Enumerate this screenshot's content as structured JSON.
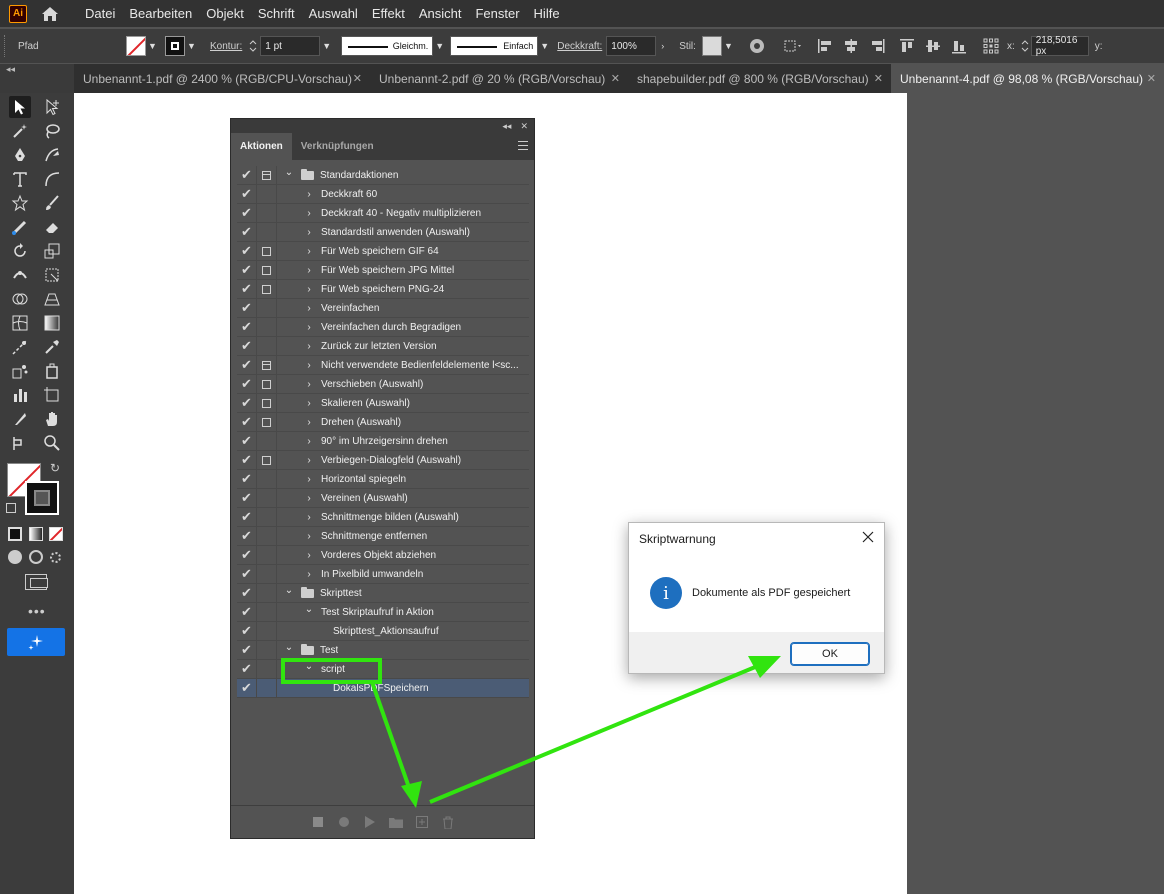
{
  "app": {
    "logo": "Ai"
  },
  "menu": [
    "Datei",
    "Bearbeiten",
    "Objekt",
    "Schrift",
    "Auswahl",
    "Effekt",
    "Ansicht",
    "Fenster",
    "Hilfe"
  ],
  "control": {
    "selection_type": "Pfad",
    "kontur_label": "Kontur:",
    "kontur_value": "1 pt",
    "line1": "Gleichm.",
    "line2": "Einfach",
    "deckkraft_label": "Deckkraft:",
    "deckkraft_value": "100%",
    "stil_label": "Stil:",
    "x_label": "x:",
    "x_value": "218,5016 px",
    "y_label": "y:"
  },
  "tabs": [
    {
      "label": "Unbenannt-1.pdf @ 2400 % (RGB/CPU-Vorschau)",
      "active": false
    },
    {
      "label": "Unbenannt-2.pdf @ 20 % (RGB/Vorschau)",
      "active": false
    },
    {
      "label": "shapebuilder.pdf @ 800 % (RGB/Vorschau)",
      "active": false
    },
    {
      "label": "Unbenannt-4.pdf @ 98,08 % (RGB/Vorschau)",
      "active": true
    }
  ],
  "panel": {
    "tab_actions": "Aktionen",
    "tab_links": "Verknüpfungen",
    "rows": [
      {
        "label": "Standardaktionen",
        "level": 0,
        "kind": "set",
        "expanded": true,
        "dialog": "half"
      },
      {
        "label": "Deckkraft 60",
        "level": 1,
        "kind": "action",
        "dialog": ""
      },
      {
        "label": "Deckkraft 40 - Negativ multiplizieren",
        "level": 1,
        "kind": "action",
        "dialog": ""
      },
      {
        "label": "Standardstil anwenden (Auswahl)",
        "level": 1,
        "kind": "action",
        "dialog": ""
      },
      {
        "label": "Für Web speichern GIF 64",
        "level": 1,
        "kind": "action",
        "dialog": "box"
      },
      {
        "label": "Für Web speichern JPG Mittel",
        "level": 1,
        "kind": "action",
        "dialog": "box"
      },
      {
        "label": "Für Web speichern PNG-24",
        "level": 1,
        "kind": "action",
        "dialog": "box"
      },
      {
        "label": "Vereinfachen",
        "level": 1,
        "kind": "action",
        "dialog": ""
      },
      {
        "label": "Vereinfachen durch Begradigen",
        "level": 1,
        "kind": "action",
        "dialog": ""
      },
      {
        "label": "Zurück zur letzten Version",
        "level": 1,
        "kind": "action",
        "dialog": ""
      },
      {
        "label": "Nicht verwendete Bedienfeldelemente l<sc...",
        "level": 1,
        "kind": "action",
        "dialog": "half"
      },
      {
        "label": "Verschieben (Auswahl)",
        "level": 1,
        "kind": "action",
        "dialog": "box"
      },
      {
        "label": "Skalieren (Auswahl)",
        "level": 1,
        "kind": "action",
        "dialog": "box"
      },
      {
        "label": "Drehen (Auswahl)",
        "level": 1,
        "kind": "action",
        "dialog": "box"
      },
      {
        "label": "90° im Uhrzeigersinn drehen",
        "level": 1,
        "kind": "action",
        "dialog": ""
      },
      {
        "label": "Verbiegen-Dialogfeld (Auswahl)",
        "level": 1,
        "kind": "action",
        "dialog": "box"
      },
      {
        "label": "Horizontal spiegeln",
        "level": 1,
        "kind": "action",
        "dialog": ""
      },
      {
        "label": "Vereinen (Auswahl)",
        "level": 1,
        "kind": "action",
        "dialog": ""
      },
      {
        "label": "Schnittmenge bilden (Auswahl)",
        "level": 1,
        "kind": "action",
        "dialog": ""
      },
      {
        "label": "Schnittmenge entfernen",
        "level": 1,
        "kind": "action",
        "dialog": ""
      },
      {
        "label": "Vorderes Objekt abziehen",
        "level": 1,
        "kind": "action",
        "dialog": ""
      },
      {
        "label": "In Pixelbild umwandeln",
        "level": 1,
        "kind": "action",
        "dialog": ""
      },
      {
        "label": "Skripttest",
        "level": 0,
        "kind": "set",
        "expanded": true,
        "dialog": ""
      },
      {
        "label": "Test Skriptaufruf in Aktion",
        "level": 1,
        "kind": "action",
        "expanded": true,
        "dialog": ""
      },
      {
        "label": "Skripttest_Aktionsaufruf",
        "level": 2,
        "kind": "step",
        "dialog": ""
      },
      {
        "label": "Test",
        "level": 0,
        "kind": "set",
        "expanded": true,
        "dialog": ""
      },
      {
        "label": "script",
        "level": 1,
        "kind": "action",
        "expanded": true,
        "dialog": ""
      },
      {
        "label": "DokalsPDFSpeichern",
        "level": 2,
        "kind": "step",
        "dialog": "",
        "selected": true
      }
    ]
  },
  "dialog": {
    "title": "Skriptwarnung",
    "message": "Dokumente als PDF gespeichert",
    "ok": "OK"
  },
  "colors": {
    "annotation": "#31e40f",
    "selection": "#4b5c75",
    "info_blue": "#1e6fbf"
  }
}
